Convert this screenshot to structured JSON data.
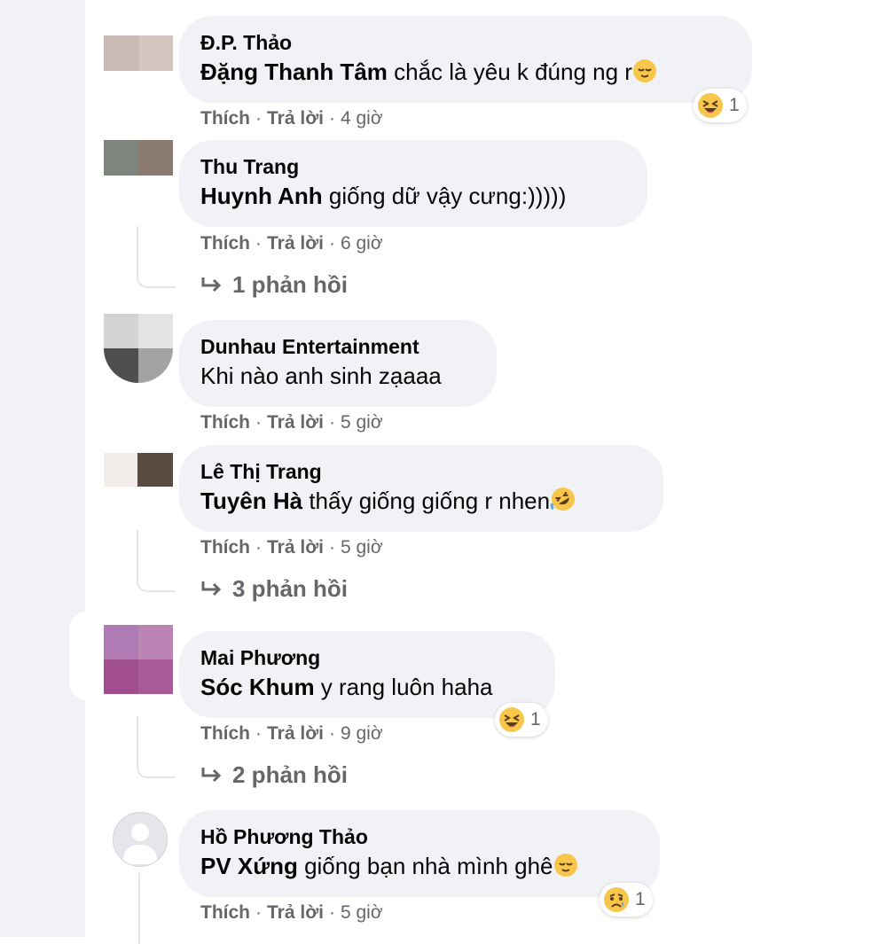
{
  "comments": [
    {
      "author": "Đ.P. Thảo",
      "mention": "Đặng Thanh Tâm",
      "text": " chắc là yêu k đúng ng r",
      "like": "Thích",
      "reply": "Trả lời",
      "time": "4 giờ",
      "reaction_count": "1",
      "reaction_icon": "laughing-emoji-icon",
      "trailing_emoji": "relieved-emoji-icon"
    },
    {
      "author": "Thu Trang",
      "mention": "Huynh Anh",
      "text": " giống dữ vậy cưng:)))))",
      "like": "Thích",
      "reply": "Trả lời",
      "time": "6 giờ",
      "replies": "1 phản hồi"
    },
    {
      "author": "Dunhau Entertainment",
      "mention": "",
      "text": "Khi nào anh sinh zạaaa",
      "like": "Thích",
      "reply": "Trả lời",
      "time": "5 giờ"
    },
    {
      "author": "Lê Thị Trang",
      "mention": "Tuyên Hà",
      "text": " thấy giống giống r nhen",
      "like": "Thích",
      "reply": "Trả lời",
      "time": "5 giờ",
      "replies": "3 phản hồi",
      "trailing_emoji": "rofl-emoji-icon"
    },
    {
      "author": "Mai Phương",
      "mention": "Sóc Khum",
      "text": " y rang luôn haha",
      "like": "Thích",
      "reply": "Trả lời",
      "time": "9 giờ",
      "replies": "2 phản hồi",
      "reaction_count": "1",
      "reaction_icon": "laughing-emoji-icon"
    },
    {
      "author": "Hồ Phương Thảo",
      "mention": "PV Xứng",
      "text": " giống bạn nhà mình ghê",
      "like": "Thích",
      "reply": "Trả lời",
      "time": "5 giờ",
      "reaction_count": "1",
      "reaction_icon": "sad-emoji-icon",
      "trailing_emoji": "relieved-emoji-icon"
    }
  ],
  "separator": "·",
  "colors": {
    "bubble": "#f0f2f5",
    "secondary_text": "#65676b",
    "primary_text": "#050505",
    "emoji_yellow": "#f7c64a"
  }
}
